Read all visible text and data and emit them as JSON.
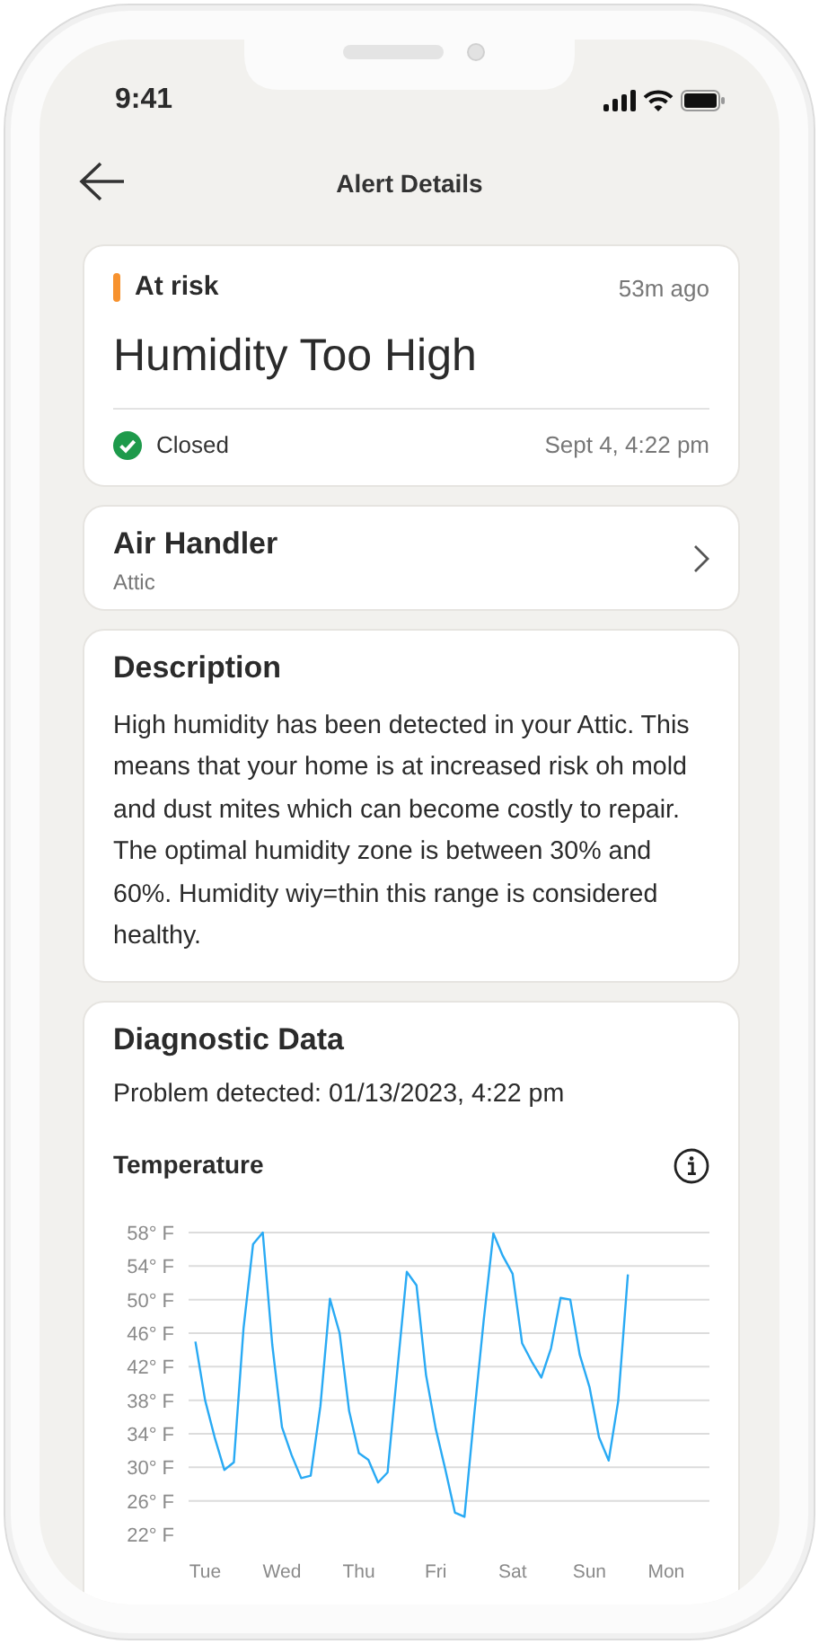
{
  "status_bar": {
    "time": "9:41"
  },
  "header": {
    "title": "Alert Details"
  },
  "alert": {
    "severity": {
      "label": "At risk",
      "kind": "at_risk"
    },
    "age": "53m ago",
    "title": "Humidity Too High",
    "status": {
      "label": "Closed",
      "kind": "closed"
    },
    "date": "Sept 4, 4:22 pm"
  },
  "device": {
    "name": "Air Handler",
    "location": "Attic"
  },
  "description": {
    "title": "Description",
    "text": "High humidity has been detected in your Attic. This means that your home is at increased risk oh mold and dust mites which can become costly to repair. The optimal humidity zone is between 30% and 60%. Humidity wiy=thin this range is considered healthy."
  },
  "diagnostics": {
    "title": "Diagnostic Data",
    "detected": "Problem detected: 01/13/2023, 4:22 pm",
    "chart": {
      "chart_data": {
        "type": "line",
        "title": "Temperature",
        "grid": true,
        "ylim": [
          22,
          58
        ],
        "categories": [
          null,
          "Tue",
          null,
          null,
          null,
          null,
          null,
          null,
          null,
          "Wed",
          null,
          null,
          null,
          null,
          null,
          null,
          null,
          "Thu",
          null,
          null,
          null,
          null,
          null,
          null,
          null,
          "Fri",
          null,
          null,
          null,
          null,
          null,
          null,
          null,
          "Sat",
          null,
          null,
          null,
          null,
          null,
          null,
          null,
          "Sun",
          null,
          null,
          null,
          null,
          null,
          null,
          null,
          "Mon",
          null
        ],
        "series": [
          {
            "color": "#29aaf4",
            "values": [
              45,
              38,
              33.6,
              29.7,
              30.6,
              46.6,
              56.6,
              58,
              44.6,
              34.8,
              31.5,
              28.7,
              29,
              37.3,
              50.1,
              46,
              36.7,
              31.7,
              30.9,
              28.2,
              29.4,
              41.5,
              53.3,
              51.7,
              41,
              34.6,
              29.8,
              24.6,
              24.1,
              36.2,
              47.5,
              57.9,
              55.2,
              53.1,
              44.8,
              42.6,
              40.7,
              44.2,
              50.2,
              50,
              43.4,
              39.6,
              33.6,
              30.8,
              37.9,
              53,
              null,
              null,
              null,
              null,
              null
            ]
          }
        ],
        "yticks": [
          {
            "value": 58,
            "label": "58° F"
          },
          {
            "value": 54,
            "label": "54° F"
          },
          {
            "value": 50,
            "label": "50° F"
          },
          {
            "value": 46,
            "label": "46° F"
          },
          {
            "value": 42,
            "label": "42° F"
          },
          {
            "value": 38,
            "label": "38° F"
          },
          {
            "value": 34,
            "label": "34° F"
          },
          {
            "value": 30,
            "label": "30° F"
          },
          {
            "value": 26,
            "label": "26° F"
          },
          {
            "value": 22,
            "label": "22° F"
          }
        ]
      }
    }
  }
}
